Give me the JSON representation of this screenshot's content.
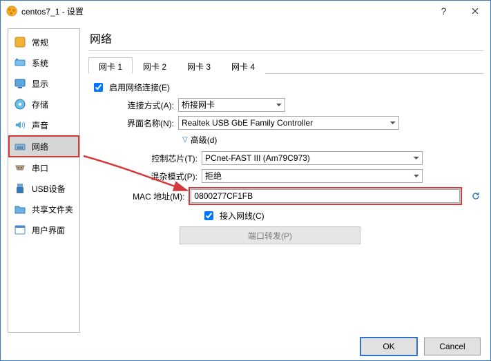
{
  "title": "centos7_1 - 设置",
  "sidebar": {
    "items": [
      {
        "label": "常规"
      },
      {
        "label": "系统"
      },
      {
        "label": "显示"
      },
      {
        "label": "存储"
      },
      {
        "label": "声音"
      },
      {
        "label": "网络"
      },
      {
        "label": "串口"
      },
      {
        "label": "USB设备"
      },
      {
        "label": "共享文件夹"
      },
      {
        "label": "用户界面"
      }
    ]
  },
  "page": {
    "title": "网络"
  },
  "tabs": [
    {
      "label": "网卡 1"
    },
    {
      "label": "网卡 2"
    },
    {
      "label": "网卡 3"
    },
    {
      "label": "网卡 4"
    }
  ],
  "form": {
    "enable_label": "启用网络连接(E)",
    "attach_label": "连接方式(A):",
    "attach_value": "桥接网卡",
    "iface_label": "界面名称(N):",
    "iface_value": "Realtek USB GbE Family Controller",
    "advanced_label": "高级(d)",
    "chip_label": "控制芯片(T):",
    "chip_value": "PCnet-FAST III (Am79C973)",
    "promisc_label": "混杂模式(P):",
    "promisc_value": "拒绝",
    "mac_label": "MAC 地址(M):",
    "mac_value": "0800277CF1FB",
    "cable_label": "接入网线(C)",
    "portfwd_label": "端口转发(P)"
  },
  "buttons": {
    "ok": "OK",
    "cancel": "Cancel"
  }
}
